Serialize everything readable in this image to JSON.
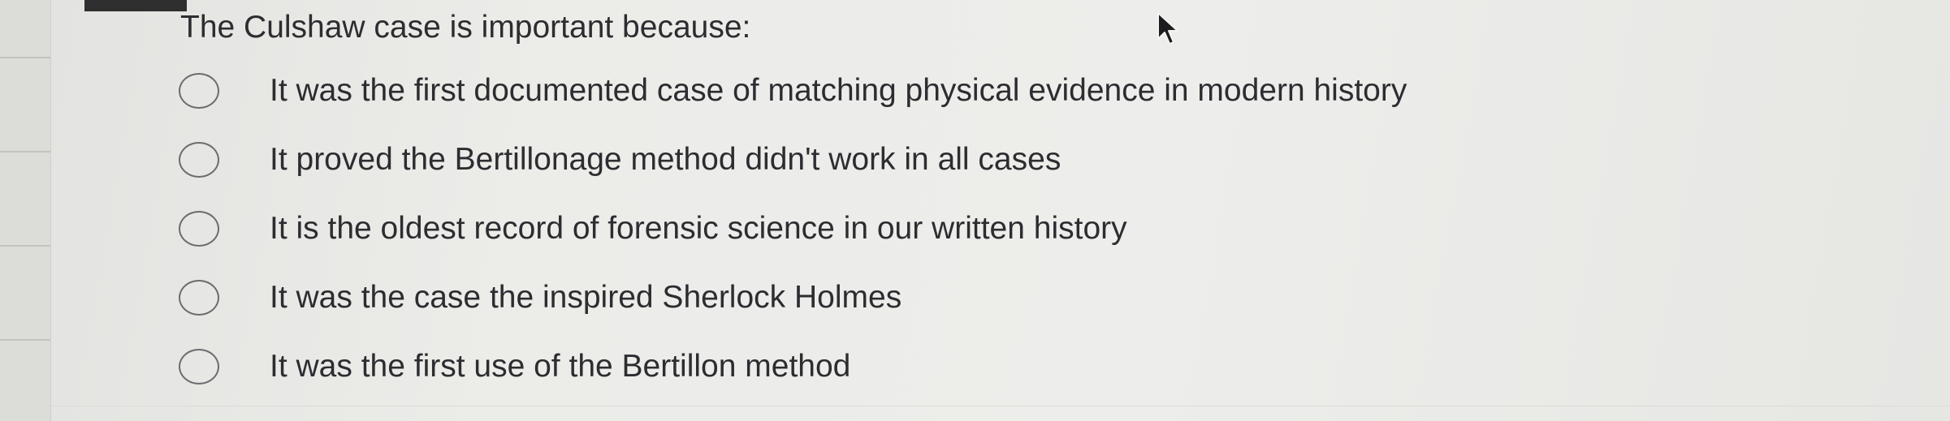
{
  "quiz": {
    "question": "The Culshaw case is important because:",
    "options": [
      {
        "label": "It was the first documented case of matching physical evidence in modern history"
      },
      {
        "label": "It proved the Bertillonage method didn't work in all cases"
      },
      {
        "label": "It is the oldest record of forensic science in our written history"
      },
      {
        "label": "It was the case the inspired Sherlock Holmes"
      },
      {
        "label": "It was the first use of the Bertillon method"
      }
    ]
  },
  "icons": {
    "cursor": "mouse-pointer-icon",
    "radio": "radio-unselected-icon"
  },
  "colors": {
    "background": "#e9e9e7",
    "text": "#2d2d31",
    "radio_border": "#6c6c6f"
  }
}
